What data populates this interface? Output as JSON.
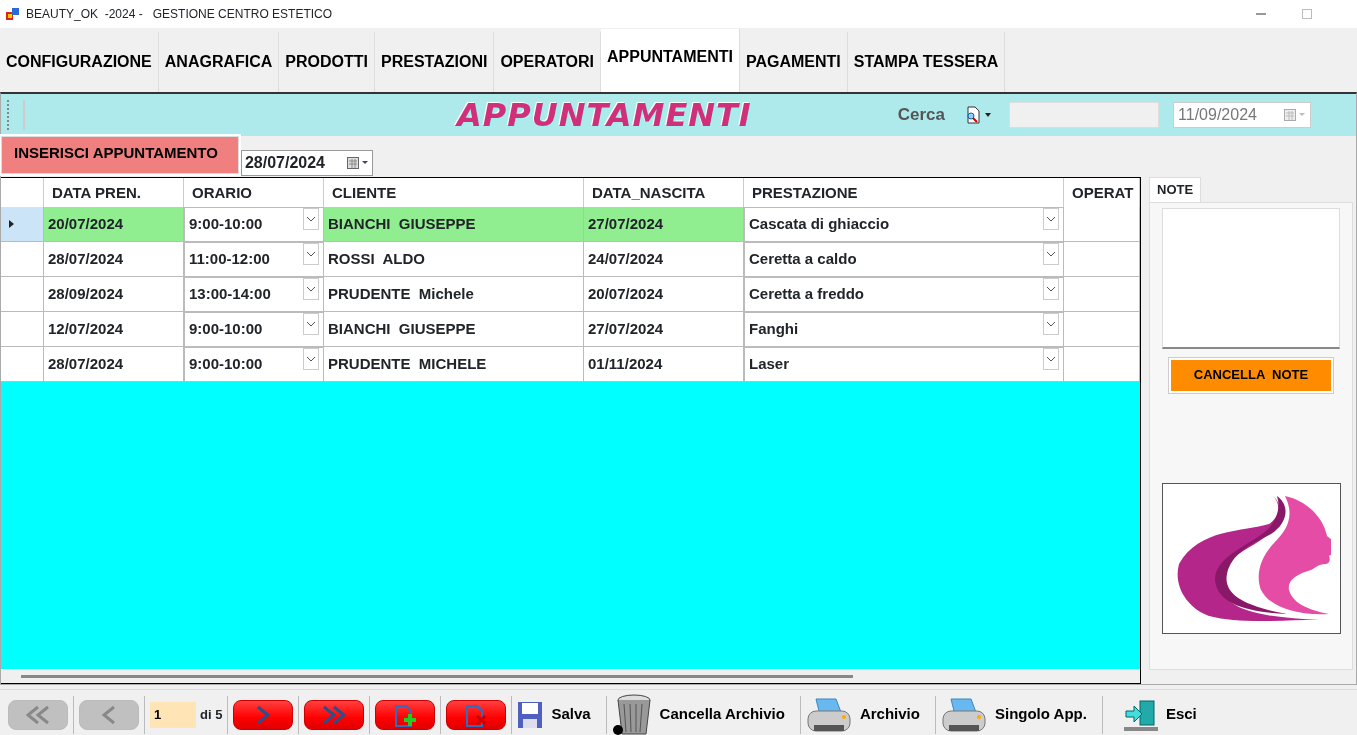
{
  "window": {
    "title": "BEAUTY_OK  -2024 -   GESTIONE CENTRO ESTETICO"
  },
  "tabs": [
    {
      "label": "CONFIGURAZIONE",
      "selected": false
    },
    {
      "label": "ANAGRAFICA",
      "selected": false
    },
    {
      "label": "PRODOTTI",
      "selected": false
    },
    {
      "label": "PRESTAZIONI",
      "selected": false
    },
    {
      "label": "OPERATORI",
      "selected": false
    },
    {
      "label": "APPUNTAMENTI",
      "selected": true
    },
    {
      "label": "PAGAMENTI",
      "selected": false
    },
    {
      "label": "STAMPA TESSERA",
      "selected": false
    }
  ],
  "header": {
    "title": "APPUNTAMENTI",
    "search_label": "Cerca",
    "date": "11/09/2024",
    "date_disabled": true
  },
  "insert_button": "INSERISCI APPUNTAMENTO",
  "date_filter": "28/07/2024",
  "table": {
    "columns": [
      {
        "label": "DATA PREN.",
        "kind": "text"
      },
      {
        "label": "ORARIO",
        "kind": "combo"
      },
      {
        "label": "CLIENTE",
        "kind": "text"
      },
      {
        "label": "DATA_NASCITA",
        "kind": "text"
      },
      {
        "label": "PRESTAZIONE",
        "kind": "combo"
      },
      {
        "label": "OPERAT",
        "kind": "text"
      }
    ],
    "rows": [
      {
        "selected": true,
        "cells": [
          "20/07/2024",
          "9:00-10:00",
          "BIANCHI  GIUSEPPE",
          "27/07/2024",
          "Cascata di ghiaccio"
        ]
      },
      {
        "selected": false,
        "cells": [
          "28/07/2024",
          "11:00-12:00",
          "ROSSI  ALDO",
          "24/07/2024",
          "Ceretta a caldo"
        ]
      },
      {
        "selected": false,
        "cells": [
          "28/09/2024",
          "13:00-14:00",
          "PRUDENTE  Michele",
          "20/07/2024",
          "Ceretta a freddo"
        ]
      },
      {
        "selected": false,
        "cells": [
          "12/07/2024",
          "9:00-10:00",
          "BIANCHI  GIUSEPPE",
          "27/07/2024",
          "Fanghi"
        ]
      },
      {
        "selected": false,
        "cells": [
          "28/07/2024",
          "9:00-10:00",
          "PRUDENTE  MICHELE",
          "01/11/2024",
          "Laser"
        ]
      }
    ]
  },
  "notes": {
    "tab": "NOTE",
    "button": "CANCELLA  NOTE"
  },
  "toolbar": [
    {
      "kind": "first",
      "disabled": true
    },
    {
      "kind": "prev",
      "disabled": true
    },
    {
      "kind": "page",
      "value": "1",
      "text": "di 5"
    },
    {
      "kind": "next",
      "disabled": false
    },
    {
      "kind": "last",
      "disabled": false
    },
    {
      "kind": "add"
    },
    {
      "kind": "delete"
    },
    {
      "kind": "save",
      "label": "Salva"
    },
    {
      "kind": "trash",
      "label": "Cancella Archivio"
    },
    {
      "kind": "print",
      "label": "Archivio"
    },
    {
      "kind": "print",
      "label": "Singolo App."
    },
    {
      "kind": "exit",
      "label": "Esci"
    }
  ]
}
